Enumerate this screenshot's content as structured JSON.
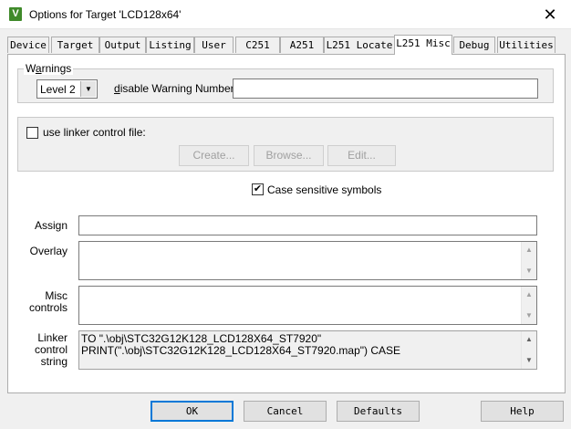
{
  "window": {
    "title": "Options for Target 'LCD128x64'",
    "app_icon_glyph": "V",
    "close_glyph": "✕"
  },
  "tabs": [
    {
      "label": "Device"
    },
    {
      "label": "Target"
    },
    {
      "label": "Output"
    },
    {
      "label": "Listing"
    },
    {
      "label": "User"
    },
    {
      "label": "C251"
    },
    {
      "label": "A251"
    },
    {
      "label": "L251 Locate"
    },
    {
      "label": "L251 Misc",
      "active": true
    },
    {
      "label": "Debug"
    },
    {
      "label": "Utilities"
    }
  ],
  "warnings": {
    "legend_pre": "W",
    "legend_ul": "a",
    "legend_post": "rnings",
    "level_value": "Level 2",
    "disable_label_ul": "d",
    "disable_label_post": "isable Warning Numbers:",
    "disable_value": ""
  },
  "linker_file": {
    "checkbox_label": "use linker control file:",
    "checked": false,
    "create_label": "Create...",
    "browse_label": "Browse...",
    "edit_label": "Edit..."
  },
  "case_sensitive": {
    "label": "Case sensitive symbols",
    "checked": true,
    "check_glyph": "✔"
  },
  "fields": {
    "assign_label": "Assign",
    "assign_value": "",
    "overlay_label": "Overlay",
    "overlay_value": "",
    "misc_label_1": "Misc",
    "misc_label_2": "controls",
    "misc_value": "",
    "linker_label_1": "Linker",
    "linker_label_2": "control",
    "linker_label_3": "string",
    "linker_string_line1": "TO \".\\obj\\STC32G12K128_LCD128X64_ST7920\"",
    "linker_string_line2": "PRINT(\".\\obj\\STC32G12K128_LCD128X64_ST7920.map\") CASE"
  },
  "icons": {
    "dropdown": "▼",
    "scroll_up": "▲",
    "scroll_down": "▼"
  },
  "footer": {
    "ok_label": "OK",
    "cancel_label": "Cancel",
    "defaults_label": "Defaults",
    "help_label": "Help"
  }
}
